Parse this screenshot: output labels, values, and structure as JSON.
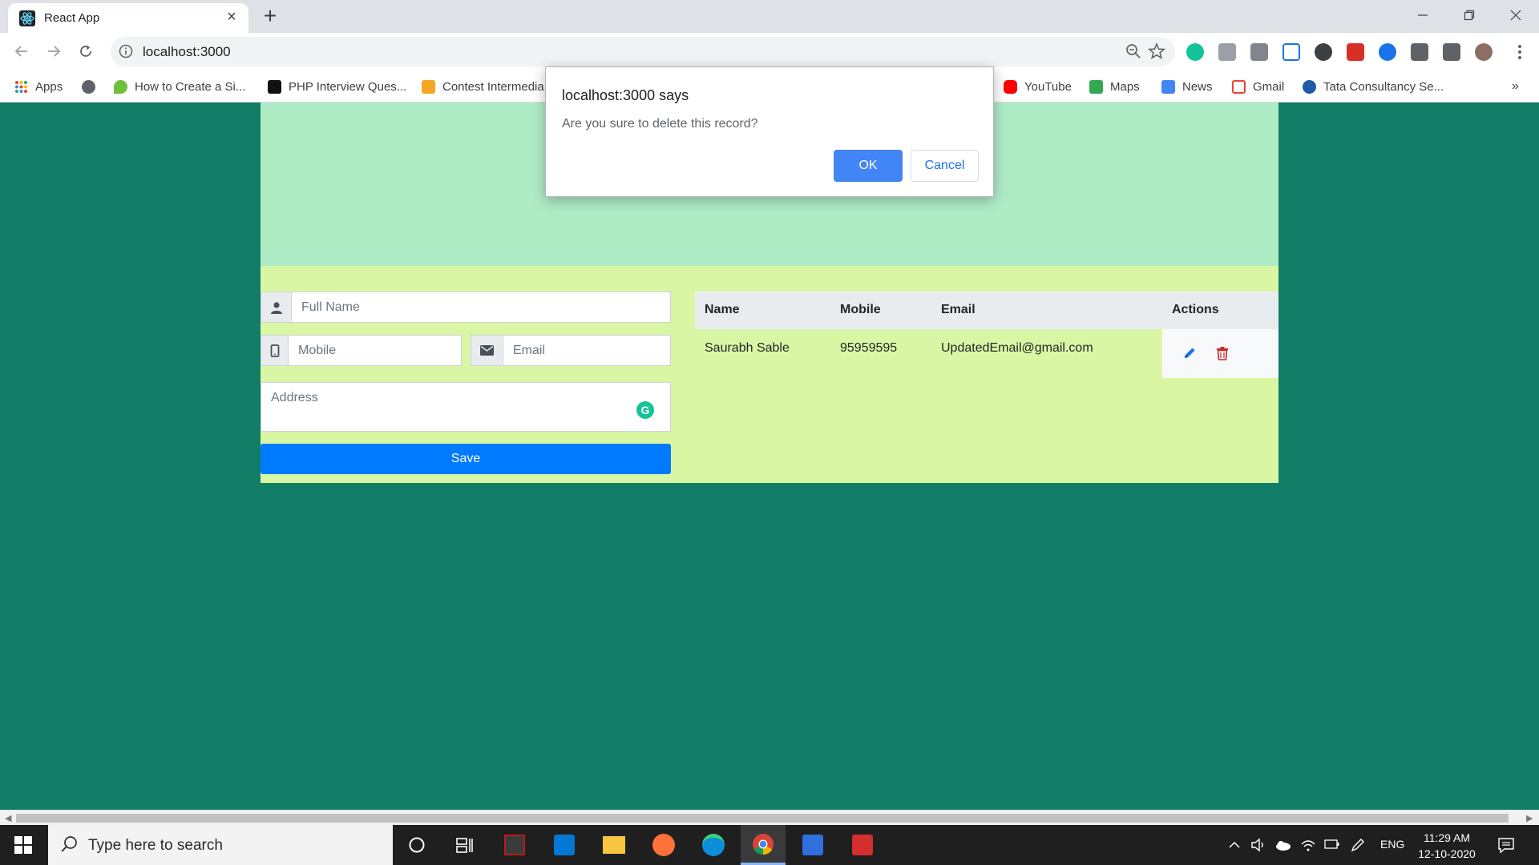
{
  "browser": {
    "tab": {
      "title": "React App",
      "favicon": "react-icon"
    },
    "url": "localhost:3000",
    "extension_icons": [
      "grammarly-icon",
      "cube-icon",
      "camera-icon",
      "ui-icon",
      "circle-icon",
      "puzzle-red-icon",
      "loop-icon",
      "puzzle-icon",
      "media-icon"
    ]
  },
  "bookmarks": {
    "apps": "Apps",
    "items": [
      "How to Create a Si...",
      "PHP Interview Ques...",
      "Contest Intermedia",
      "YouTube",
      "Maps",
      "News",
      "Gmail",
      "Tata Consultancy Se..."
    ]
  },
  "form": {
    "full_name_placeholder": "Full Name",
    "mobile_placeholder": "Mobile",
    "email_placeholder": "Email",
    "address_placeholder": "Address",
    "save_label": "Save"
  },
  "table": {
    "headers": [
      "Name",
      "Mobile",
      "Email",
      "Actions"
    ],
    "rows": [
      {
        "name": "Saurabh Sable",
        "mobile": "95959595",
        "email": "UpdatedEmail@gmail.com"
      }
    ]
  },
  "dialog": {
    "title": "localhost:3000 says",
    "message": "Are you sure to delete this record?",
    "ok_label": "OK",
    "cancel_label": "Cancel"
  },
  "taskbar": {
    "search_placeholder": "Type here to search",
    "language": "ENG",
    "time": "11:29 AM",
    "date": "12-10-2020"
  },
  "colors": {
    "page_background": "#117d66",
    "hero_background": "#aeecc6",
    "panel_background": "#d9f6a5",
    "save_button": "#007bff",
    "dialog_ok": "#4285f4"
  }
}
